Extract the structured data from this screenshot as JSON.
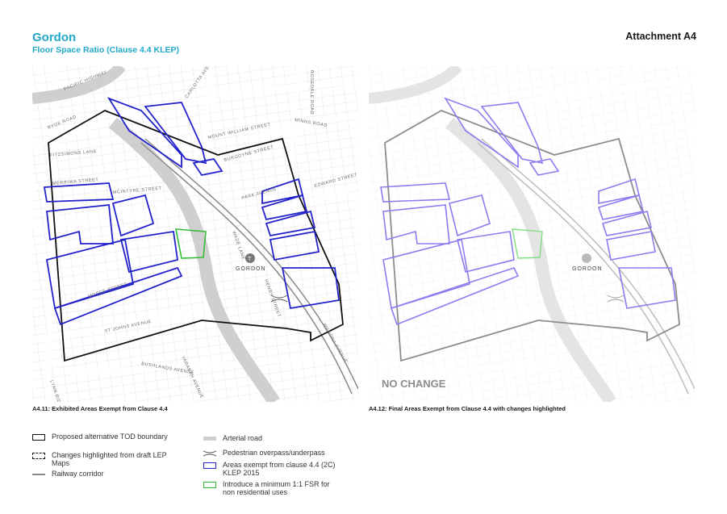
{
  "header": {
    "title": "Gordon",
    "subtitle": "Floor Space Ratio (Clause 4.4 KLEP)",
    "attachment": "Attachment A4"
  },
  "colors": {
    "accent": "#22a8c9",
    "boundary": "#111111",
    "exempt": "#2222cc",
    "exempt_light": "#8c7cf0",
    "min_fsr": "#33bb33",
    "arterial": "#cfcfcf",
    "railway": "#8a8a8a"
  },
  "maps": {
    "left": {
      "caption": "A4.11:  Exhibited Areas Exempt from Clause 4.4",
      "station": "GORDON",
      "streets": {
        "pacific_highway": "PACIFIC HIGHWAY",
        "ryde_road": "RYDE ROAD",
        "carlotta": "CARLOTTA AVENUE",
        "rosedale": "ROSEDALE ROAD",
        "mount_william": "MOUNT WILLIAM STREET",
        "minns": "MINNS ROAD",
        "burgoyne": "BURGOYNE STREET",
        "fitzsimons": "FITZSIMONS LANE",
        "merriwa": "MERRIWA STREET",
        "mcintyre": "MCINTYRE STREET",
        "park": "PARK AVENUE",
        "edward": "EDWARD STREET",
        "werona": "WERONA AVENUE",
        "henry": "HENRY STREET",
        "st_johns": "ST JOHNS AVENUE",
        "bushlands": "BUSHLANDS AVENUE",
        "lynn_ridge": "LYNN RIDGE AVENUE",
        "yarabah": "YARABAH AVENUE",
        "wade": "WADE LANE",
        "moree": "MOREE STREET"
      }
    },
    "right": {
      "caption": "A4.12:  Final Areas Exempt from Clause 4.4 with changes highlighted",
      "overlay": "NO CHANGE",
      "station": "GORDON"
    }
  },
  "legend": {
    "items": [
      {
        "key": "boundary",
        "label": "Proposed alternative TOD boundary"
      },
      {
        "key": "changes",
        "label": "Changes highlighted from draft LEP Maps"
      },
      {
        "key": "railway",
        "label": "Railway corridor"
      },
      {
        "key": "arterial",
        "label": "Arterial road"
      },
      {
        "key": "pedestrian",
        "label": "Pedestrian overpass/underpass"
      },
      {
        "key": "exempt",
        "label": "Areas exempt from clause 4.4 (2C) KLEP 2015"
      },
      {
        "key": "min_fsr",
        "label": "Introduce a minimum 1:1 FSR for non residential uses"
      }
    ]
  }
}
